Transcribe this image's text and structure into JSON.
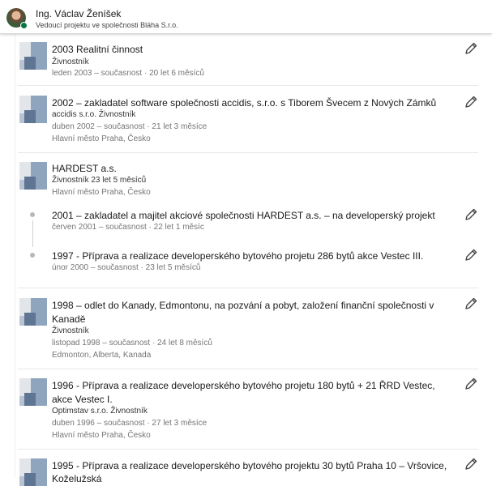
{
  "header": {
    "name": "Ing. Václav Ženíšek",
    "headline": "Vedoucí projektu ve společnosti Bláha S.r.o."
  },
  "experience": {
    "e1": {
      "title": "2003 Realitní činnost",
      "subtitle": "Živnostník",
      "dates": "leden 2003 – současnost · 20 let 6 měsíců"
    },
    "e2": {
      "title": "2002 – zakladatel software společnosti accidis, s.r.o. s Tiborem Švecem z Nových Zámků",
      "subtitle": "accidis s.r.o. Živnostník",
      "dates": "duben 2002 – současnost · 21 let 3 měsíce",
      "location": "Hlavní město Praha, Česko"
    },
    "e3": {
      "company": "HARDEST a.s.",
      "subtitle": "Živnostník 23 let 5 měsíců",
      "location": "Hlavní město Praha, Česko",
      "roles": [
        {
          "title": "2001 – zakladatel a majitel akciové společnosti HARDEST a.s. – na developerský projekt",
          "dates": "červen 2001 – současnost · 22 let 1 měsíc"
        },
        {
          "title": "1997 - Příprava a realizace developerského bytového projetu 286 bytů akce Vestec III.",
          "dates": "únor 2000 – současnost · 23 let 5 měsíců"
        }
      ]
    },
    "e4": {
      "title_line1": "1998 – odlet do Kanady, Edmontonu, na pozvání a pobyt, založení finanční společnosti v",
      "title_line2": "Kanadě",
      "subtitle": "Živnostník",
      "dates": "listopad 1998 – současnost · 24 let 8 měsíců",
      "location": "Edmonton, Alberta, Kanada"
    },
    "e5": {
      "title_line1": "1996 - Příprava a realizace developerského bytového projetu 180 bytů + 21 ŘRD Vestec,",
      "title_line2": "akce Vestec I.",
      "subtitle": "Optimstav s.r.o. Živnostník",
      "dates": "duben 1996 – současnost · 27 let 3 měsíce",
      "location": "Hlavní město Praha, Česko"
    },
    "e6": {
      "title_line1": "1995 - Příprava a realizace developerského bytového projektu 30 bytů Praha 10 – Vršovice,",
      "title_line2": "Koželužská"
    }
  },
  "icons": {
    "edit": "pencil-icon",
    "logo": "company-logo-placeholder"
  },
  "colors": {
    "online": "#057642",
    "meta_text": "#767676",
    "separator": "#e8e8e8"
  }
}
